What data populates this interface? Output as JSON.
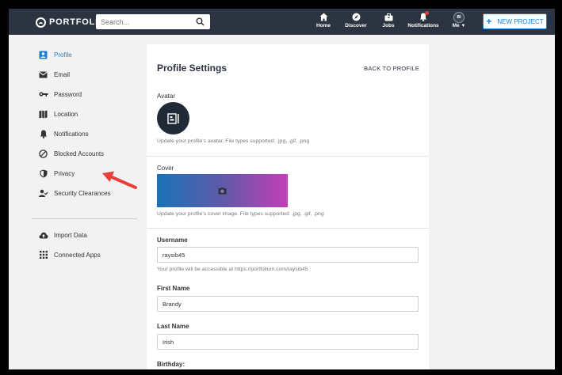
{
  "header": {
    "logo_text": "PORTFOLIUM",
    "search_placeholder": "Search...",
    "nav": [
      {
        "label": "Home",
        "icon": "home-icon"
      },
      {
        "label": "Discover",
        "icon": "compass-icon"
      },
      {
        "label": "Jobs",
        "icon": "briefcase-icon"
      },
      {
        "label": "Notifications",
        "icon": "bell-icon"
      },
      {
        "label": "Me",
        "icon": "user-avatar"
      }
    ],
    "me_initials": "BI",
    "new_project_label": "NEW PROJECT",
    "colors": {
      "bar": "#2b3440",
      "accent": "#1d7dd4"
    }
  },
  "sidebar": {
    "items": [
      {
        "label": "Profile",
        "icon": "profile-card-icon",
        "active": true
      },
      {
        "label": "Email",
        "icon": "envelope-icon"
      },
      {
        "label": "Password",
        "icon": "key-icon"
      },
      {
        "label": "Location",
        "icon": "map-icon"
      },
      {
        "label": "Notifications",
        "icon": "bell-icon"
      },
      {
        "label": "Blocked Accounts",
        "icon": "blocked-icon"
      },
      {
        "label": "Privacy",
        "icon": "shield-icon"
      },
      {
        "label": "Security Clearances",
        "icon": "user-check-icon"
      }
    ],
    "secondary": [
      {
        "label": "Import Data",
        "icon": "cloud-upload-icon"
      },
      {
        "label": "Connected Apps",
        "icon": "grid-icon"
      }
    ]
  },
  "profile": {
    "title": "Profile Settings",
    "back_label": "BACK TO PROFILE",
    "avatar_label": "Avatar",
    "avatar_help": "Update your profile's avatar. File types supported: .jpg, .gif, .png",
    "cover_label": "Cover",
    "cover_help": "Update your profile's cover image. File types supported: .jpg, .gif, .png",
    "username_label": "Username",
    "username_value": "raysib45",
    "username_help": "Your profile will be accessible at https://portfolium.com/raysib45",
    "first_name_label": "First Name",
    "first_name_value": "Brandy",
    "last_name_label": "Last Name",
    "last_name_value": "Irish",
    "birthday_label": "Birthday:"
  }
}
